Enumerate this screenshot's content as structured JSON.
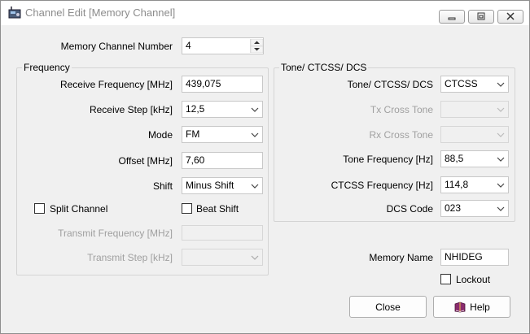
{
  "window": {
    "title": "Channel Edit [Memory Channel]"
  },
  "memory_channel": {
    "label": "Memory Channel Number",
    "value": "4"
  },
  "frequency_group": {
    "title": "Frequency",
    "receive_frequency": {
      "label": "Receive Frequency [MHz]",
      "value": "439,075"
    },
    "receive_step": {
      "label": "Receive Step [kHz]",
      "value": "12,5"
    },
    "mode": {
      "label": "Mode",
      "value": "FM"
    },
    "offset": {
      "label": "Offset [MHz]",
      "value": "7,60"
    },
    "shift": {
      "label": "Shift",
      "value": "Minus Shift"
    },
    "split_channel": {
      "label": "Split Channel",
      "checked": false
    },
    "beat_shift": {
      "label": "Beat Shift",
      "checked": false
    },
    "transmit_frequency": {
      "label": "Transmit Frequency [MHz]",
      "value": ""
    },
    "transmit_step": {
      "label": "Transmit Step [kHz]",
      "value": ""
    }
  },
  "tone_group": {
    "title": "Tone/ CTCSS/ DCS",
    "tone_mode": {
      "label": "Tone/ CTCSS/ DCS",
      "value": "CTCSS"
    },
    "tx_cross_tone": {
      "label": "Tx Cross Tone",
      "value": ""
    },
    "rx_cross_tone": {
      "label": "Rx Cross Tone",
      "value": ""
    },
    "tone_frequency": {
      "label": "Tone Frequency [Hz]",
      "value": "88,5"
    },
    "ctcss_frequency": {
      "label": "CTCSS Frequency [Hz]",
      "value": "114,8"
    },
    "dcs_code": {
      "label": "DCS Code",
      "value": "023"
    }
  },
  "memory_name": {
    "label": "Memory Name",
    "value": "NHIDEG"
  },
  "lockout": {
    "label": "Lockout",
    "checked": false
  },
  "buttons": {
    "close": "Close",
    "help": "Help"
  },
  "icons": {
    "app": "radio-app-icon",
    "minimize": "minimize-icon",
    "maximize": "maximize-icon",
    "close": "close-icon",
    "help": "help-book-icon"
  }
}
